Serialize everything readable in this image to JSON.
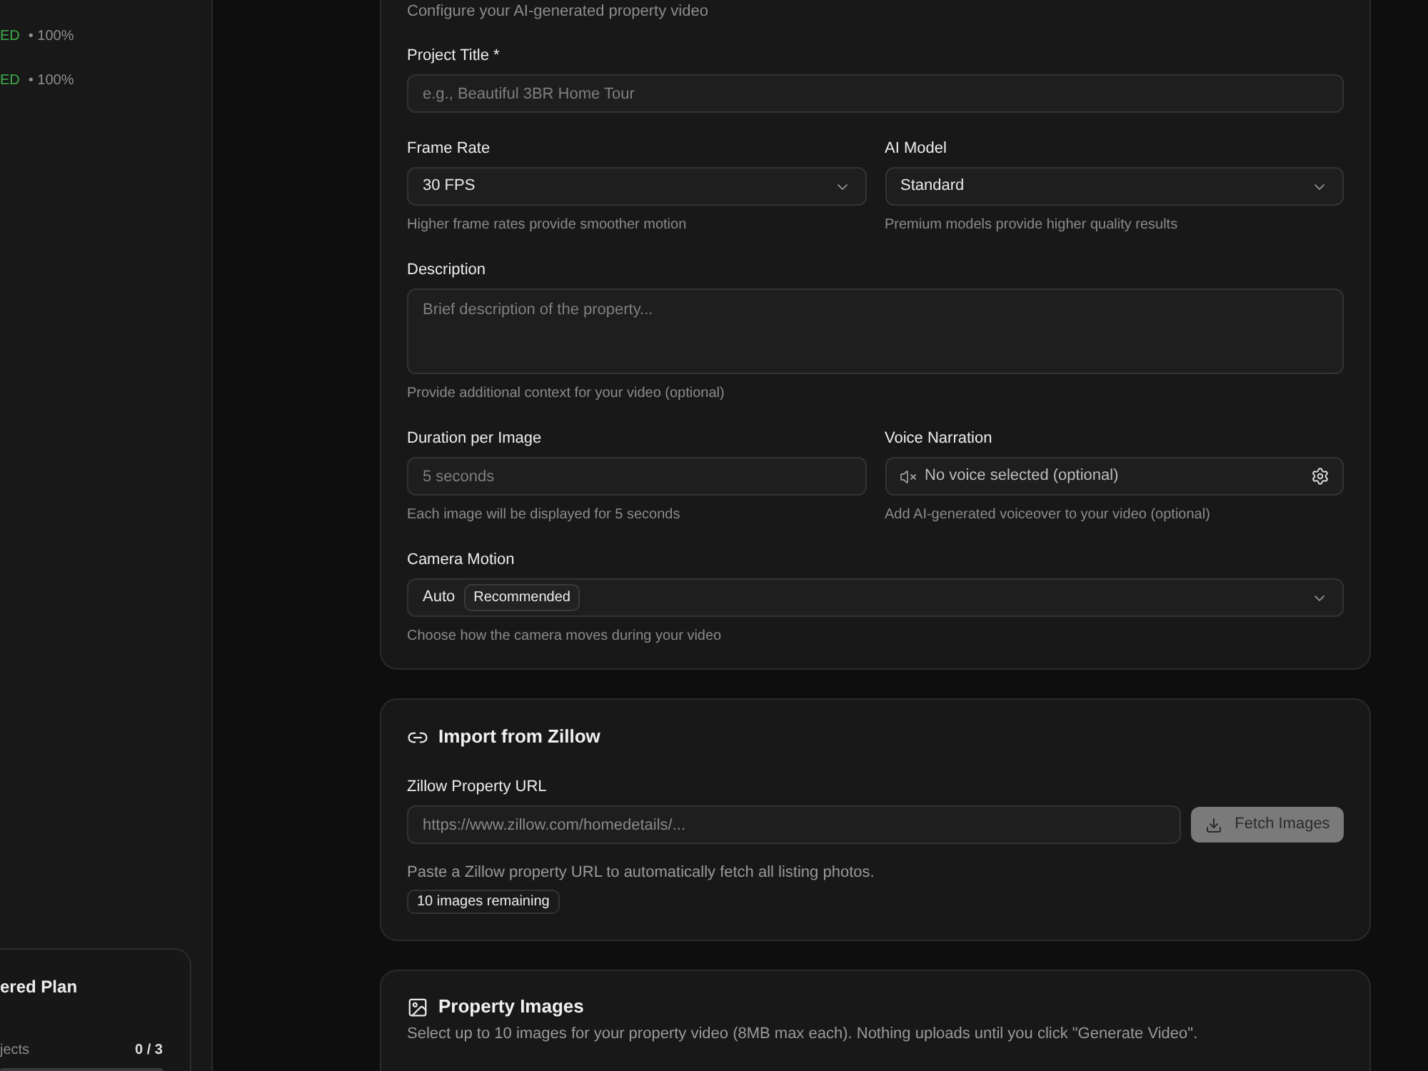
{
  "sidebar": {
    "projects": [
      {
        "status": "ED",
        "progress": "• 100%"
      },
      {
        "status": "ED",
        "progress": "• 100%"
      }
    ],
    "plan": {
      "title": "ered Plan",
      "usage_label": "jects",
      "usage_value": "0 / 3",
      "level": 0
    }
  },
  "video_settings": {
    "subtitle": "Configure your AI-generated property video",
    "rows": [
      [
        {
          "kind": "input",
          "label": "Project Title *",
          "placeholder": "e.g., Beautiful 3BR Home Tour"
        }
      ],
      [
        {
          "kind": "select",
          "label": "Frame Rate",
          "value": "30 FPS",
          "help": "Higher frame rates provide smoother motion"
        },
        {
          "kind": "select",
          "label": "AI Model",
          "value": "Standard",
          "help": "Premium models provide higher quality results"
        }
      ],
      [
        {
          "kind": "textarea",
          "label": "Description",
          "placeholder": "Brief description of the property...",
          "help": "Provide additional context for your video (optional)"
        }
      ],
      [
        {
          "kind": "input",
          "label": "Duration per Image",
          "placeholder": "5 seconds",
          "help": "Each image will be displayed for 5 seconds"
        },
        {
          "kind": "voice",
          "label": "Voice Narration",
          "value": "No voice selected (optional)",
          "help": "Add AI-generated voiceover to your video (optional)"
        }
      ],
      [
        {
          "kind": "select",
          "label": "Camera Motion",
          "value": "Auto",
          "badge": "Recommended",
          "help": "Choose how the camera moves during your video"
        }
      ]
    ]
  },
  "zillow_import": {
    "title": "Import from Zillow",
    "url_label": "Zillow Property URL",
    "url_placeholder": "https://www.zillow.com/homedetails/...",
    "fetch_button": {
      "label": "Fetch Images",
      "disabled": true
    },
    "help": "Paste a Zillow property URL to automatically fetch all listing photos.",
    "remaining": "10 images remaining"
  },
  "property_images": {
    "title": "Property Images",
    "description": "Select up to 10 images for your property video (8MB max each). Nothing uploads until you click \"Generate Video\"."
  }
}
